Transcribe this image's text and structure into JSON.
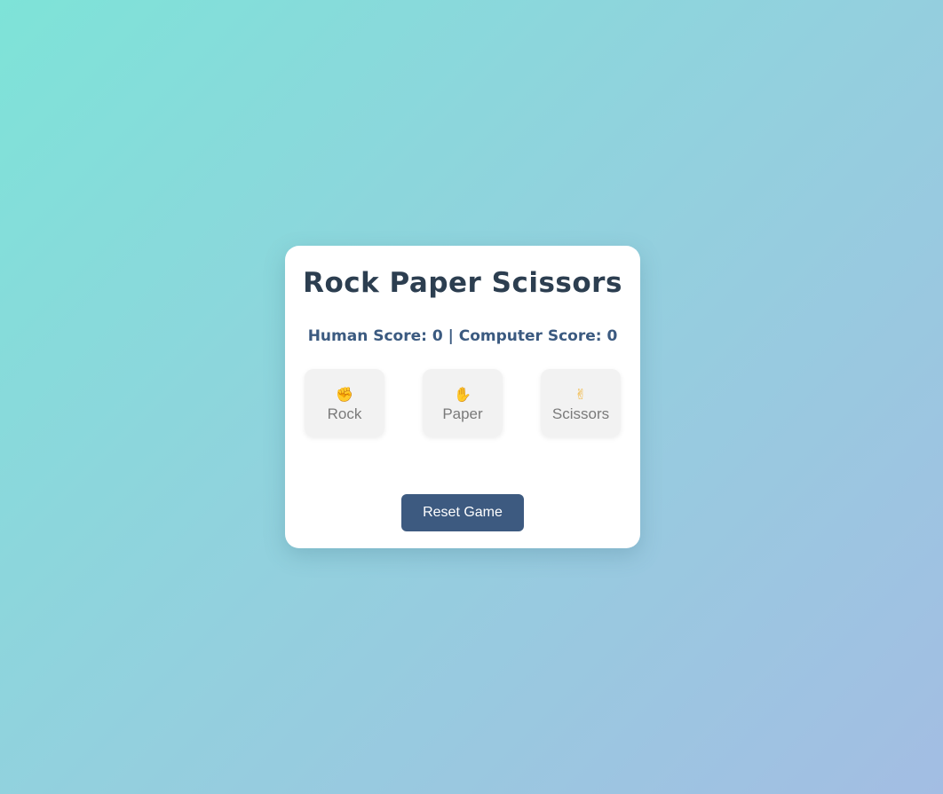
{
  "game": {
    "title": "Rock Paper Scissors",
    "score_text": "Human Score: 0 | Computer Score: 0",
    "choices": [
      {
        "emoji": "✊",
        "label": "Rock",
        "icon": "raised-fist-icon"
      },
      {
        "emoji": "✋",
        "label": "Paper",
        "icon": "raised-hand-icon"
      },
      {
        "emoji": "✌",
        "label": "Scissors",
        "icon": "victory-hand-icon"
      }
    ],
    "reset_label": "Reset Game"
  },
  "colors": {
    "title": "#2c3e50",
    "score": "#3b5a80",
    "button": "#3d5a80",
    "choice_bg": "#f2f2f2"
  }
}
